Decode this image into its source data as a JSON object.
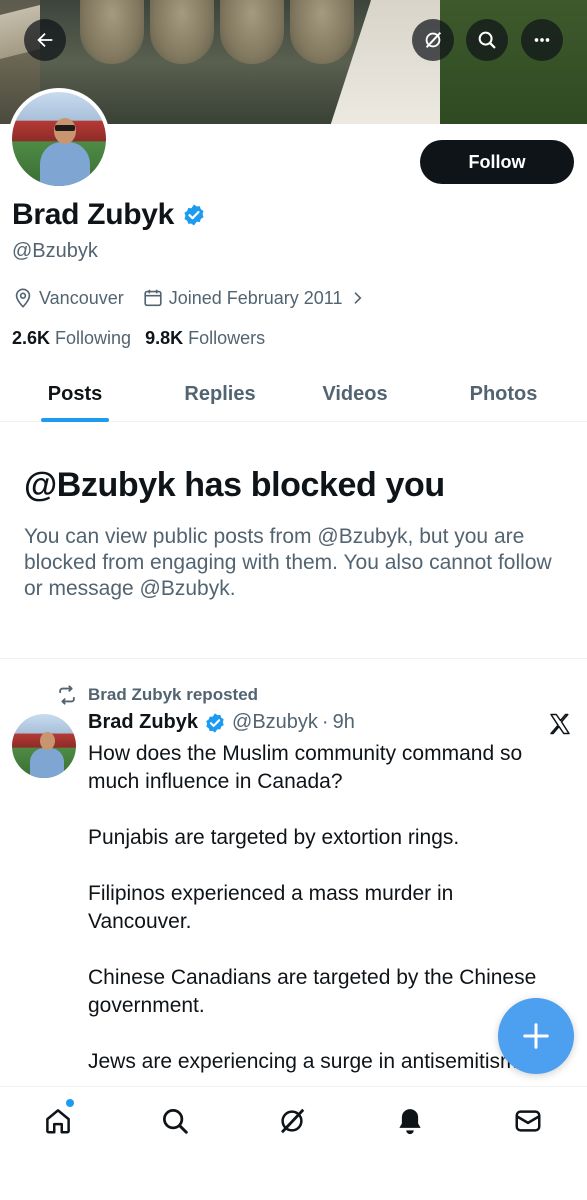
{
  "header": {
    "back_icon": "arrow-left-icon",
    "grok_icon": "grok-icon",
    "search_icon": "search-icon",
    "more_icon": "more-horizontal-icon"
  },
  "profile": {
    "display_name": "Brad Zubyk",
    "handle": "@Bzubyk",
    "verified": true,
    "location": "Vancouver",
    "joined": "Joined February 2011",
    "following_count": "2.6K",
    "following_label": "Following",
    "followers_count": "9.8K",
    "followers_label": "Followers",
    "follow_button_label": "Follow"
  },
  "tabs": [
    {
      "label": "Posts",
      "active": true
    },
    {
      "label": "Replies",
      "active": false
    },
    {
      "label": "Videos",
      "active": false
    },
    {
      "label": "Photos",
      "active": false
    }
  ],
  "blocked_notice": {
    "title": "@Bzubyk has blocked you",
    "text": "You can view public posts from @Bzubyk, but you are blocked from engaging with them. You also cannot follow or message @Bzubyk."
  },
  "post": {
    "repost_label": "Brad Zubyk reposted",
    "author_name": "Brad Zubyk",
    "author_handle": "@Bzubyk",
    "separator": "·",
    "time": "9h",
    "paragraphs": [
      "How does the Muslim community command so much influence in Canada?",
      "Punjabis are targeted by extortion rings.",
      "Filipinos experienced a mass murder in Vancouver.",
      "Chinese Canadians are targeted by the Chinese government.",
      "Jews are experiencing a surge in antisemitism"
    ]
  },
  "colors": {
    "accent": "#1d9bf0",
    "text_primary": "#0f1419",
    "text_secondary": "#536471",
    "fab": "#4d9ff0"
  },
  "bottom_nav": [
    {
      "name": "home-icon",
      "has_dot": true
    },
    {
      "name": "search-icon"
    },
    {
      "name": "grok-icon"
    },
    {
      "name": "notifications-bell-icon"
    },
    {
      "name": "messages-envelope-icon"
    }
  ]
}
